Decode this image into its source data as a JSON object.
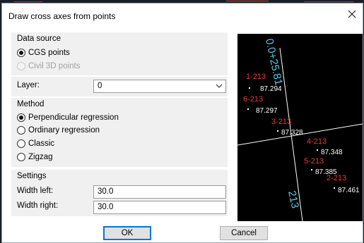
{
  "dialog": {
    "title": "Draw cross axes from points",
    "close_glyph": "✕"
  },
  "data_source": {
    "label": "Data source",
    "options": [
      {
        "label": "CGS points",
        "checked": true,
        "disabled": false
      },
      {
        "label": "Civil 3D points",
        "checked": false,
        "disabled": true
      }
    ]
  },
  "layer": {
    "label": "Layer:",
    "value": "0"
  },
  "method": {
    "label": "Method",
    "options": [
      {
        "label": "Perpendicular regression",
        "checked": true
      },
      {
        "label": "Ordinary regression",
        "checked": false
      },
      {
        "label": "Classic",
        "checked": false
      },
      {
        "label": "Zigzag",
        "checked": false
      }
    ]
  },
  "settings": {
    "label": "Settings",
    "width_left_label": "Width left:",
    "width_left_value": "30.0",
    "width_right_label": "Width right:",
    "width_right_value": "30.0"
  },
  "buttons": {
    "ok": "OK",
    "cancel": "Cancel"
  },
  "preview": {
    "station_top": "0.0+25.81",
    "station_bottom": "213",
    "points": [
      {
        "id": "1-213",
        "elev": "87.294"
      },
      {
        "id": "6-213",
        "elev": "87.297"
      },
      {
        "id": "3-213",
        "elev": "87.328"
      },
      {
        "id": "4-213",
        "elev": "87.348"
      },
      {
        "id": "5-213",
        "elev": "87.385"
      },
      {
        "id": "2-213",
        "elev": "87.461"
      }
    ],
    "colors": {
      "background": "#000000",
      "point_id": "#e83a3a",
      "elevation": "#ffffff",
      "station": "#5bc8e6",
      "axis": "#ffffff"
    }
  }
}
